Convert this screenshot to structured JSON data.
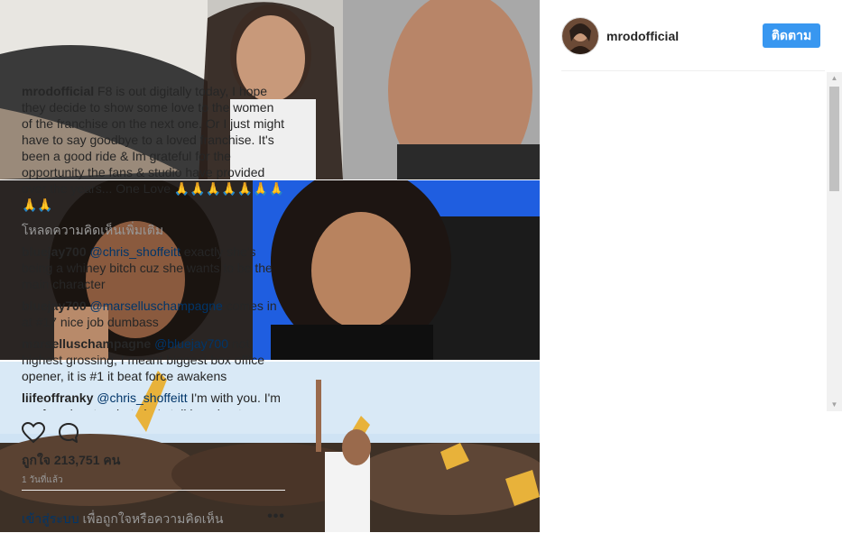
{
  "post": {
    "username": "mrodofficial",
    "follow_label": "ติดตาม",
    "caption_user": "mrodofficial",
    "caption_text": "F8 is out digitally today, I hope they decide to show some love to the women of the franchise on the next one. Or I just might have to say goodbye to a loved franchise. It's been a good ride & Im grateful for the opportunity the fans & studio have provided over the years... One Love 🙏🙏🙏🙏🙏🙏🙏🙏🙏",
    "load_more": "โหลดความคิดเห็นเพิ่มเติม",
    "comments": [
      {
        "user": "bluejay700",
        "mention": "@chris_shoffeitt",
        "text": " exactly she's being a whiney bitch cuz she wants to be the main character"
      },
      {
        "user": "bluejay700",
        "mention": "@marselluschampagne",
        "text": " comes in at #17 nice job dumbass"
      },
      {
        "user": "marselluschampagne",
        "mention": "@bluejay700",
        "text": " not highest grossing, I meant biggest box office opener, it is #1 it beat force awakens"
      },
      {
        "user": "liifeoffranky",
        "mention": "@chris_shoffeitt",
        "text": " I'm with you. I'm confused as to what she's talking about"
      }
    ],
    "likes": "ถูกใจ 213,751 คน",
    "time_ago": "1 วันที่แล้ว",
    "login_link": "เข้าสู่ระบบ",
    "login_rest": " เพื่อถูกใจหรือความคิดเห็น",
    "more_label": "•••"
  },
  "icons": {
    "like": "heart-icon",
    "comment": "comment-bubble-icon",
    "more": "ellipsis-icon"
  },
  "colors": {
    "follow_button": "#3897f0",
    "link": "#003569",
    "muted": "#999999"
  }
}
